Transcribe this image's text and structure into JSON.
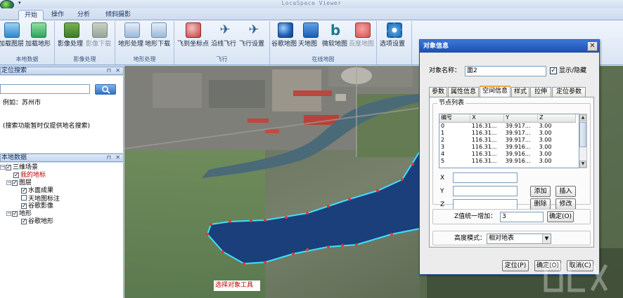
{
  "app": {
    "title": "LocaSpace Viewer"
  },
  "ribbon_tabs": [
    "开始",
    "操作",
    "分析",
    "倾斜摄影"
  ],
  "ribbon_groups": [
    {
      "label": "本地数据",
      "buttons": [
        {
          "label": "加载图层",
          "icon": "load-layer-icon"
        },
        {
          "label": "加载地形",
          "icon": "load-terrain-icon"
        }
      ]
    },
    {
      "label": "影像处理",
      "buttons": [
        {
          "label": "影像处理",
          "icon": "image-process-icon"
        },
        {
          "label": "影像下载",
          "icon": "image-download-icon"
        }
      ]
    },
    {
      "label": "地形处理",
      "buttons": [
        {
          "label": "地形处理",
          "icon": "terrain-process-icon"
        },
        {
          "label": "地形下载",
          "icon": "terrain-download-icon"
        }
      ]
    },
    {
      "label": "飞行",
      "buttons": [
        {
          "label": "飞到坐标点",
          "icon": "fly-to-coord-icon"
        },
        {
          "label": "沿线飞行",
          "icon": "fly-along-line-icon"
        },
        {
          "label": "飞行设置",
          "icon": "flight-settings-icon"
        }
      ]
    },
    {
      "label": "在线地图",
      "buttons": [
        {
          "label": "谷歌地图",
          "icon": "google-earth-icon"
        },
        {
          "label": "天地图",
          "icon": "tianditu-icon"
        },
        {
          "label": "微软地图",
          "icon": "bing-icon"
        },
        {
          "label": "百度地图",
          "icon": "baidu-icon"
        }
      ]
    },
    {
      "label": "",
      "buttons": [
        {
          "label": "选项设置",
          "icon": "gear-icon"
        }
      ]
    }
  ],
  "search_panel": {
    "title": "定位搜索",
    "input_value": "",
    "example": "例如：苏州市",
    "note": "(搜索功能暂时仅提供地名搜索)"
  },
  "tree_panel": {
    "title": "本地数据",
    "nodes": [
      {
        "label": "三维场景",
        "checked": true
      },
      {
        "label": "我的地标",
        "checked": true
      },
      {
        "label": "图层",
        "checked": true
      },
      {
        "label": "水面成果",
        "checked": true
      },
      {
        "label": "天地图标注",
        "checked": false
      },
      {
        "label": "谷歌影像",
        "checked": true
      },
      {
        "label": "地形",
        "checked": true
      },
      {
        "label": "谷歌地形",
        "checked": true
      }
    ]
  },
  "map": {
    "status_label": "选择对象工具"
  },
  "dialog": {
    "title": "对象信息",
    "name_label": "对象名称：",
    "name_value": "面2",
    "show_hide_label": "显示/隐藏",
    "show_hide_checked": true,
    "tabs": [
      "参数",
      "属性信息",
      "空间信息",
      "样式",
      "拉伸",
      "定位参数"
    ],
    "active_tab": "空间信息",
    "node_list_title": "节点列表",
    "columns": [
      "编号",
      "X",
      "Y",
      "Z"
    ],
    "rows": [
      [
        "0",
        "116.31...",
        "39.917...",
        "3.00"
      ],
      [
        "1",
        "116.31...",
        "39.917...",
        "3.00"
      ],
      [
        "2",
        "116.31...",
        "39.917...",
        "3.00"
      ],
      [
        "3",
        "116.31...",
        "39.916...",
        "3.00"
      ],
      [
        "4",
        "116.31...",
        "39.916...",
        "3.00"
      ],
      [
        "5",
        "116.31...",
        "39.916...",
        "3.00"
      ]
    ],
    "x_label": "X",
    "y_label": "Y",
    "z_label": "Z",
    "btn_add": "添加",
    "btn_insert": "插入",
    "btn_delete": "删除",
    "btn_modify": "修改",
    "z_increase_label": "Z值统一增加：",
    "z_increase_value": "3",
    "btn_confirm_z": "确定(O)",
    "height_mode_label": "高度模式：",
    "height_mode_value": "相对地表",
    "btn_locate": "定位(P)",
    "btn_ok": "确定(O)",
    "btn_cancel": "取消(C)"
  },
  "colors": {
    "ribbon_accent": "#8da9cf",
    "dialog_title": "#1c4fae",
    "polygon_fill": "#1a3f7a",
    "polygon_outline": "#3fe0ff",
    "vertex": "#e0392f"
  }
}
